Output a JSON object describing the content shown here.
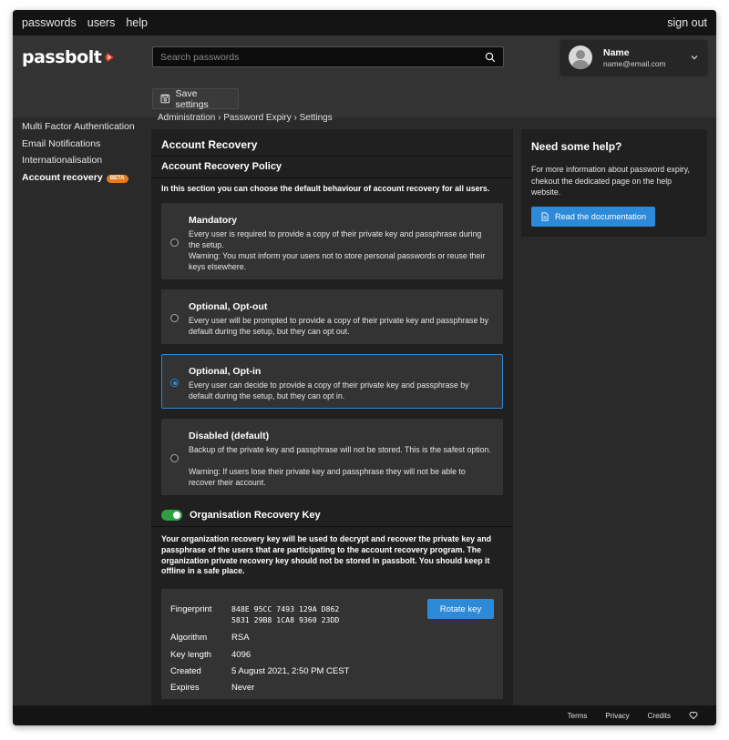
{
  "topnav": {
    "links": [
      "passwords",
      "users",
      "help"
    ],
    "signout": "sign out"
  },
  "brand": {
    "name": "passbolt",
    "accent": "#e63b25"
  },
  "search": {
    "placeholder": "Search passwords"
  },
  "profile": {
    "name": "Name",
    "email": "name@email.com"
  },
  "toolbar": {
    "save_label": "Save settings"
  },
  "sidebar": {
    "items": [
      {
        "label": "Multi Factor Authentication"
      },
      {
        "label": "Email Notifications"
      },
      {
        "label": "Internationalisation"
      },
      {
        "label": "Account recovery",
        "badge": "BETA"
      }
    ]
  },
  "breadcrumb": "Administration › Password Expiry › Settings",
  "main": {
    "title": "Account Recovery",
    "policy_title": "Account Recovery Policy",
    "intro": "In this section you can choose the default behaviour of account recovery for all users.",
    "options": [
      {
        "title": "Mandatory",
        "desc": "Every user is required to provide a copy of their private key and passphrase during the setup.",
        "warning": "Warning: You must inform your users not to store personal passwords or reuse their keys elsewhere."
      },
      {
        "title": "Optional, Opt-out",
        "desc": "Every user will be prompted to provide a copy of their private key and passphrase by default during the setup, but they can opt out.",
        "warning": ""
      },
      {
        "title": "Optional, Opt-in",
        "desc": "Every user can decide to provide a copy of their private key and passphrase by default during the setup, but they can opt in.",
        "warning": ""
      },
      {
        "title": "Disabled (default)",
        "desc": "Backup of the private key and passphrase will not be stored. This is the safest option.",
        "warning": "Warning: If users lose their private key and passphrase they will not be able to recover their account."
      }
    ],
    "selected_option": "Optional, Opt-in",
    "org_key": {
      "title": "Organisation Recovery Key",
      "enabled": true,
      "desc": "Your organization recovery key will be used to decrypt and recover the private key and passphrase of the users that are participating to the account recovery program. The organization private recovery key should not be stored in passbolt. You should keep it offline in a safe place.",
      "fingerprint_label": "Fingerprint",
      "fingerprint_line1": "848E 95CC 7493 129A D862",
      "fingerprint_line2": "5831 29B8 1CA8 9360 23DD",
      "algorithm_label": "Algorithm",
      "algorithm": "RSA",
      "key_length_label": "Key length",
      "key_length": "4096",
      "created_label": "Created",
      "created": "5 August 2021, 2:50 PM CEST",
      "expires_label": "Expires",
      "expires": "Never",
      "rotate_label": "Rotate key"
    }
  },
  "help": {
    "title": "Need some help?",
    "text": "For more information about password expiry, chekout the dedicated page on the help website.",
    "button": "Read the documentation"
  },
  "footer": {
    "links": [
      "Terms",
      "Privacy",
      "Credits"
    ]
  },
  "colors": {
    "primary": "#2d8ad8",
    "toggle_on": "#2ea043",
    "beta": "#e8791f"
  }
}
